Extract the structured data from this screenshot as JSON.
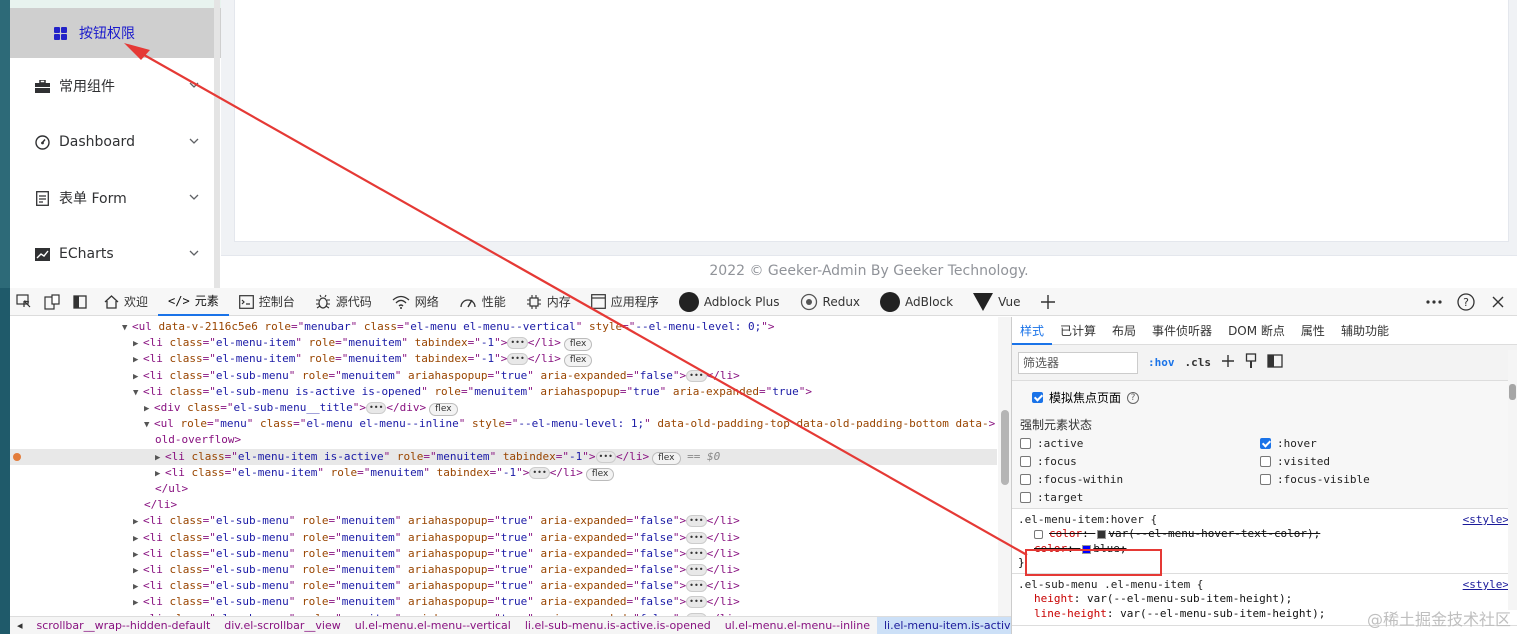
{
  "sidebar": {
    "active_item": "按钮权限",
    "items": [
      {
        "label": "常用组件",
        "icon": "briefcase-icon"
      },
      {
        "label": "Dashboard",
        "icon": "gauge-icon"
      },
      {
        "label": "表单 Form",
        "icon": "document-icon"
      },
      {
        "label": "ECharts",
        "icon": "chart-icon"
      }
    ]
  },
  "footer": {
    "text": "2022 © Geeker-Admin By Geeker Technology."
  },
  "devtools": {
    "tabs": [
      "欢迎",
      "元素",
      "控制台",
      "源代码",
      "网络",
      "性能",
      "内存",
      "应用程序",
      "Adblock Plus",
      "Redux",
      "AdBlock",
      "Vue"
    ],
    "active_tab": "元素",
    "dom_lines": [
      {
        "indent": 10,
        "tri": "▼",
        "tag": "ul",
        "attrs": [
          [
            "data-v-2116c5e6",
            null
          ],
          [
            "role",
            "menubar"
          ],
          [
            "class",
            "el-menu el-menu--vertical"
          ],
          [
            "style",
            "--el-menu-level: 0;"
          ]
        ],
        "close": false,
        "ellip": false,
        "badge": null
      },
      {
        "indent": 11,
        "tri": "▶",
        "tag": "li",
        "attrs": [
          [
            "class",
            "el-menu-item"
          ],
          [
            "role",
            "menuitem"
          ],
          [
            "tabindex",
            "-1"
          ]
        ],
        "close": true,
        "ellip": true,
        "badge": "flex"
      },
      {
        "indent": 11,
        "tri": "▶",
        "tag": "li",
        "attrs": [
          [
            "class",
            "el-menu-item"
          ],
          [
            "role",
            "menuitem"
          ],
          [
            "tabindex",
            "-1"
          ]
        ],
        "close": true,
        "ellip": true,
        "badge": "flex"
      },
      {
        "indent": 11,
        "tri": "▶",
        "tag": "li",
        "attrs": [
          [
            "class",
            "el-sub-menu"
          ],
          [
            "role",
            "menuitem"
          ],
          [
            "ariahaspopup",
            "true"
          ],
          [
            "aria-expanded",
            "false"
          ]
        ],
        "close": true,
        "ellip": true,
        "badge": null
      },
      {
        "indent": 11,
        "tri": "▼",
        "tag": "li",
        "attrs": [
          [
            "class",
            "el-sub-menu is-active is-opened"
          ],
          [
            "role",
            "menuitem"
          ],
          [
            "ariahaspopup",
            "true"
          ],
          [
            "aria-expanded",
            "true"
          ]
        ],
        "close": false,
        "ellip": false,
        "badge": null
      },
      {
        "indent": 12,
        "tri": "▶",
        "tag": "div",
        "attrs": [
          [
            "class",
            "el-sub-menu__title"
          ]
        ],
        "close": true,
        "ellip": true,
        "badge": "flex"
      },
      {
        "indent": 12,
        "tri": "▼",
        "tag": "ul",
        "attrs": [
          [
            "role",
            "menu"
          ],
          [
            "class",
            "el-menu el-menu--inline"
          ],
          [
            "style",
            "--el-menu-level: 1;"
          ],
          [
            "data-old-padding-top",
            null
          ],
          [
            "data-old-padding-bottom",
            null
          ],
          [
            "data-",
            null
          ]
        ],
        "close": false,
        "ellip": false,
        "badge": null
      },
      {
        "indent": 13,
        "raw": "old-overflow>"
      },
      {
        "indent": 13,
        "tri": "▶",
        "tag": "li",
        "attrs": [
          [
            "class",
            "el-menu-item is-active"
          ],
          [
            "role",
            "menuitem"
          ],
          [
            "tabindex",
            "-1"
          ]
        ],
        "close": true,
        "ellip": true,
        "badge": "flex",
        "selected": true,
        "eq": "== $0"
      },
      {
        "indent": 13,
        "tri": "▶",
        "tag": "li",
        "attrs": [
          [
            "class",
            "el-menu-item"
          ],
          [
            "role",
            "menuitem"
          ],
          [
            "tabindex",
            "-1"
          ]
        ],
        "close": true,
        "ellip": true,
        "badge": "flex"
      },
      {
        "indent": 13,
        "raw": "</ul>"
      },
      {
        "indent": 12,
        "raw": "</li>"
      },
      {
        "indent": 11,
        "tri": "▶",
        "tag": "li",
        "attrs": [
          [
            "class",
            "el-sub-menu"
          ],
          [
            "role",
            "menuitem"
          ],
          [
            "ariahaspopup",
            "true"
          ],
          [
            "aria-expanded",
            "false"
          ]
        ],
        "close": true,
        "ellip": true,
        "badge": null
      },
      {
        "indent": 11,
        "tri": "▶",
        "tag": "li",
        "attrs": [
          [
            "class",
            "el-sub-menu"
          ],
          [
            "role",
            "menuitem"
          ],
          [
            "ariahaspopup",
            "true"
          ],
          [
            "aria-expanded",
            "false"
          ]
        ],
        "close": true,
        "ellip": true,
        "badge": null
      },
      {
        "indent": 11,
        "tri": "▶",
        "tag": "li",
        "attrs": [
          [
            "class",
            "el-sub-menu"
          ],
          [
            "role",
            "menuitem"
          ],
          [
            "ariahaspopup",
            "true"
          ],
          [
            "aria-expanded",
            "false"
          ]
        ],
        "close": true,
        "ellip": true,
        "badge": null
      },
      {
        "indent": 11,
        "tri": "▶",
        "tag": "li",
        "attrs": [
          [
            "class",
            "el-sub-menu"
          ],
          [
            "role",
            "menuitem"
          ],
          [
            "ariahaspopup",
            "true"
          ],
          [
            "aria-expanded",
            "false"
          ]
        ],
        "close": true,
        "ellip": true,
        "badge": null
      },
      {
        "indent": 11,
        "tri": "▶",
        "tag": "li",
        "attrs": [
          [
            "class",
            "el-sub-menu"
          ],
          [
            "role",
            "menuitem"
          ],
          [
            "ariahaspopup",
            "true"
          ],
          [
            "aria-expanded",
            "false"
          ]
        ],
        "close": true,
        "ellip": true,
        "badge": null
      },
      {
        "indent": 11,
        "tri": "▶",
        "tag": "li",
        "attrs": [
          [
            "class",
            "el-sub-menu"
          ],
          [
            "role",
            "menuitem"
          ],
          [
            "ariahaspopup",
            "true"
          ],
          [
            "aria-expanded",
            "false"
          ]
        ],
        "close": true,
        "ellip": true,
        "badge": null
      },
      {
        "indent": 11,
        "tri": "▶",
        "tag": "li",
        "attrs": [
          [
            "class",
            "el-sub-menu"
          ],
          [
            "role",
            "menuitem"
          ],
          [
            "ariahaspopup",
            "true"
          ],
          [
            "aria-expanded",
            "false"
          ]
        ],
        "close": true,
        "ellip": true,
        "badge": null
      }
    ],
    "breadcrumbs": [
      "scrollbar__wrap--hidden-default",
      "div.el-scrollbar__view",
      "ul.el-menu.el-menu--vertical",
      "li.el-sub-menu.is-active.is-opened",
      "ul.el-menu.el-menu--inline",
      "li.el-menu-item.is-active"
    ],
    "styles_tabs": [
      "样式",
      "已计算",
      "布局",
      "事件侦听器",
      "DOM 断点",
      "属性",
      "辅助功能"
    ],
    "filter_placeholder": "筛选器",
    "hov": ":hov",
    "cls": ".cls",
    "focus_page_label": "模拟焦点页面",
    "force_state_label": "强制元素状态",
    "pseudo_states": [
      {
        "label": ":active",
        "checked": false
      },
      {
        "label": ":hover",
        "checked": true
      },
      {
        "label": ":focus",
        "checked": false
      },
      {
        "label": ":visited",
        "checked": false
      },
      {
        "label": ":focus-within",
        "checked": false
      },
      {
        "label": ":focus-visible",
        "checked": false
      },
      {
        "label": ":target",
        "checked": false
      }
    ],
    "rules": [
      {
        "selector": ".el-menu-item:hover {",
        "source": "<style>",
        "props": [
          {
            "name": "color",
            "value": "var(--el-menu-hover-text-color);",
            "swatch": "#333333",
            "strike": true
          },
          {
            "name": "color",
            "value": "blue;",
            "swatch": "#0000ff",
            "strike": true
          }
        ],
        "close": "}"
      },
      {
        "selector": ".el-sub-menu .el-menu-item {",
        "source": "<style>",
        "props": [
          {
            "name": "height",
            "value": "var(--el-menu-sub-item-height);",
            "swatch": null,
            "strike": false
          },
          {
            "name": "line-height",
            "value": "var(--el-menu-sub-item-height);",
            "swatch": null,
            "strike": false
          }
        ],
        "close": ""
      }
    ]
  },
  "watermark": "@稀土掘金技术社区",
  "colors": {
    "accent": "#1a73e8",
    "active_menu_text": "#1a1acc",
    "annotation_red": "#e53935"
  }
}
